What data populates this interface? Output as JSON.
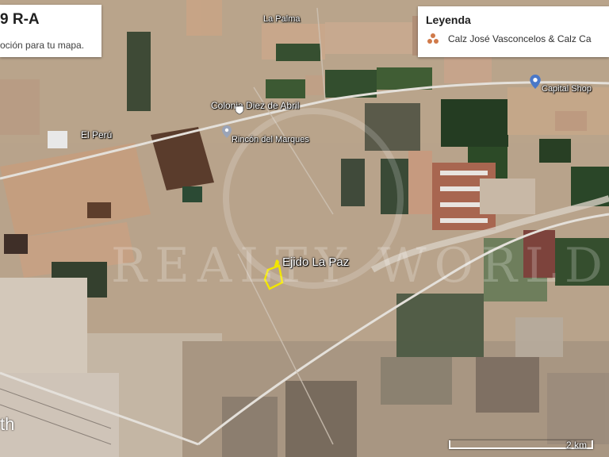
{
  "header_panel": {
    "title": "9 R-A",
    "subtitle": "oción para tu mapa."
  },
  "legend": {
    "title": "Leyenda",
    "item_label": "Calz José Vasconcelos & Calz Ca",
    "item_icon": "three-dot-cluster-icon"
  },
  "places": {
    "la_palma": "La Palma",
    "colonia": "Colonia Diez de Abril",
    "el_peru": "El Perú",
    "rincon": "Rincón del Marques",
    "capital_shop": "Capital Shop",
    "ejido": "Ejido La Paz"
  },
  "scale": {
    "label": "2 km"
  },
  "watermark": "REALTY WORLD",
  "corner_text": "th",
  "colors": {
    "marker": "#f2e600",
    "highway": "#f0f0f0",
    "field_green": "#2e4a26",
    "field_tan": "#c49e7f"
  }
}
